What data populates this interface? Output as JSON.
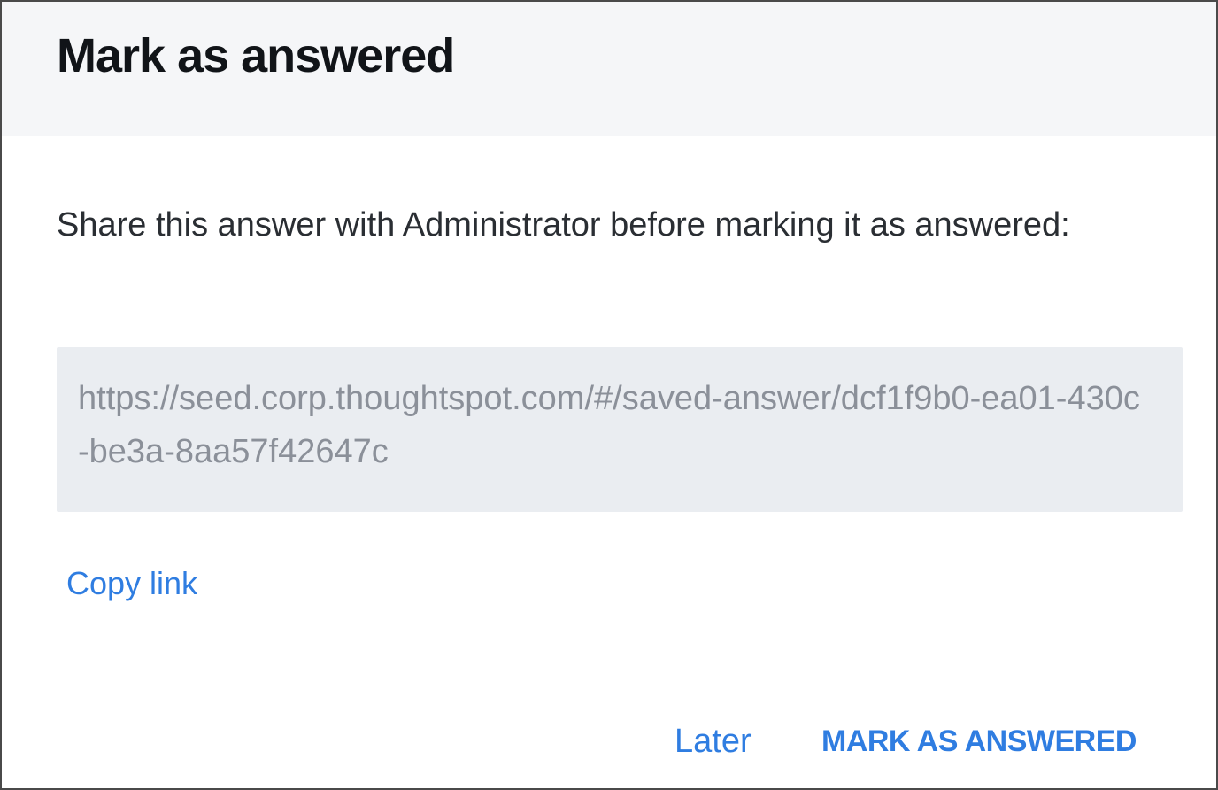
{
  "dialog": {
    "title": "Mark as answered",
    "message": "Share this answer with Administrator before marking it as answered:",
    "link_url": "https://seed.corp.thoughtspot.com/#/saved-answer/dcf1f9b0-ea01-430c-be3a-8aa57f42647c",
    "copy_link_label": "Copy link",
    "later_label": "Later",
    "mark_answered_label": "MARK AS ANSWERED"
  },
  "colors": {
    "accent": "#2f7de1",
    "header_bg": "#f5f6f8",
    "link_box_bg": "#eaedf1",
    "link_text": "#8b9099"
  }
}
